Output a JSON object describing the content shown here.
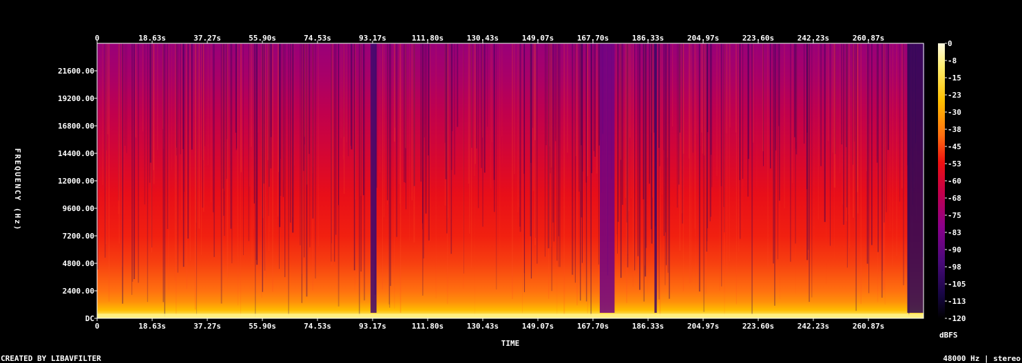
{
  "chart_data": {
    "type": "heatmap",
    "xlabel": "TIME",
    "ylabel": "FREQUENCY (Hz)",
    "footer_left": "CREATED BY LIBAVFILTER",
    "footer_right": "48000 Hz | stereo",
    "colorbar_unit": "dBFS",
    "x_tick_labels": [
      "0",
      "18.63s",
      "37.27s",
      "55.90s",
      "74.53s",
      "93.17s",
      "111.80s",
      "130.43s",
      "149.07s",
      "167.70s",
      "186.33s",
      "204.97s",
      "223.60s",
      "242.23s",
      "260.87s"
    ],
    "x_tick_values": [
      0,
      18.63,
      37.27,
      55.9,
      74.53,
      93.17,
      111.8,
      130.43,
      149.07,
      167.7,
      186.33,
      204.97,
      223.6,
      242.23,
      260.87
    ],
    "xlim": [
      0,
      279.5
    ],
    "y_tick_labels": [
      "DC",
      "2400.00",
      "4800.00",
      "7200.00",
      "9600.00",
      "12000.00",
      "14400.00",
      "16800.00",
      "19200.00",
      "21600.00"
    ],
    "y_tick_values": [
      0,
      2400,
      4800,
      7200,
      9600,
      12000,
      14400,
      16800,
      19200,
      21600
    ],
    "ylim": [
      0,
      24000
    ],
    "colorbar_labels": [
      "0",
      "-8",
      "-15",
      "-23",
      "-30",
      "-38",
      "-45",
      "-53",
      "-60",
      "-68",
      "-75",
      "-83",
      "-90",
      "-98",
      "-105",
      "-113",
      "-120"
    ],
    "colorbar_values": [
      0,
      -7.5,
      -15,
      -22.5,
      -30,
      -37.5,
      -45,
      -52.5,
      -60,
      -67.5,
      -75,
      -82.5,
      -90,
      -97.5,
      -105,
      -112.5,
      -120
    ],
    "colorbar_range": [
      -120,
      0
    ],
    "colormap": [
      {
        "level": 0,
        "color": "#fffbe0"
      },
      {
        "level": -10,
        "color": "#ffee70"
      },
      {
        "level": -25,
        "color": "#ffc000"
      },
      {
        "level": -40,
        "color": "#ff7010"
      },
      {
        "level": -52,
        "color": "#ee1010"
      },
      {
        "level": -65,
        "color": "#c4004a"
      },
      {
        "level": -80,
        "color": "#8a008a"
      },
      {
        "level": -95,
        "color": "#4a0a7a"
      },
      {
        "level": -110,
        "color": "#160642"
      },
      {
        "level": -120,
        "color": "#000000"
      }
    ],
    "quiet_segments": [
      {
        "start": 92.5,
        "end": 94.5,
        "level": -98
      },
      {
        "start": 170,
        "end": 175,
        "level": -86
      },
      {
        "start": 188.5,
        "end": 189.3,
        "level": -100
      },
      {
        "start": 274,
        "end": 279.5,
        "level": -104
      }
    ]
  }
}
